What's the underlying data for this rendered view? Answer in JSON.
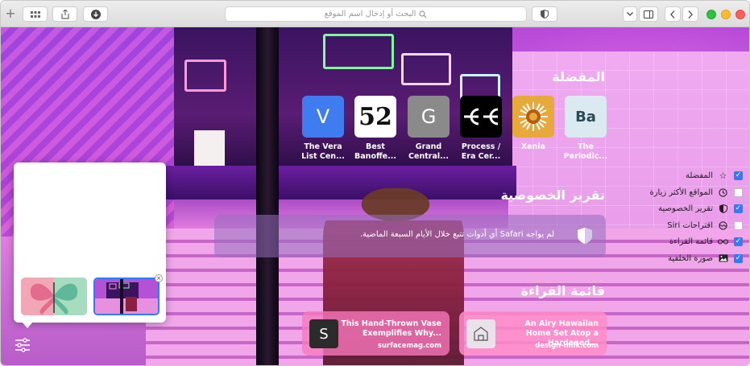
{
  "toolbar": {
    "search_placeholder": "البحث أو إدخال اسم الموقع"
  },
  "favorites": {
    "title": "المفضلة",
    "items": [
      {
        "tile": "V",
        "label": "The Vera List Cen...",
        "color": "#3f7cf0"
      },
      {
        "tile": "52",
        "label": "Best Banoffe...",
        "color": "#ffffff"
      },
      {
        "tile": "G",
        "label": "Grand Central...",
        "color": "#8a8a8a"
      },
      {
        "tile": "∈∈",
        "label": "Process / Era Cer...",
        "color": "#000000"
      },
      {
        "tile": "",
        "label": "Xenia",
        "color": "#e8a93b"
      },
      {
        "tile": "Ba",
        "label": "The Periodic...",
        "color": "#dbeaf0"
      }
    ]
  },
  "privacy": {
    "title": "تقرير الخصوصية",
    "text": "لم يواجه Safari أي أدوات تتبع خلال الأيام السبعة الماضية."
  },
  "reading_list": {
    "title": "قائمة القراءة",
    "items": [
      {
        "thumb": "S",
        "title": "This Hand-Thrown Vase Exemplifies Why...",
        "domain": "surfacemag.com"
      },
      {
        "thumb": "",
        "title": "An Airy Hawaiian Home Set Atop a Hardened...",
        "domain": "design-milk.com"
      }
    ]
  },
  "customize": {
    "options": [
      {
        "label": "المفضلة",
        "checked": true,
        "icon": "star-icon"
      },
      {
        "label": "المواقع الأكثر زيارة",
        "checked": false,
        "icon": "clock-icon"
      },
      {
        "label": "تقرير الخصوصية",
        "checked": true,
        "icon": "shield-icon"
      },
      {
        "label": "اقتراحات Siri",
        "checked": false,
        "icon": "siri-icon"
      },
      {
        "label": "قائمة القراءة",
        "checked": true,
        "icon": "glasses-icon"
      },
      {
        "label": "صورة الخلفية",
        "checked": true,
        "icon": "photo-icon"
      }
    ]
  }
}
